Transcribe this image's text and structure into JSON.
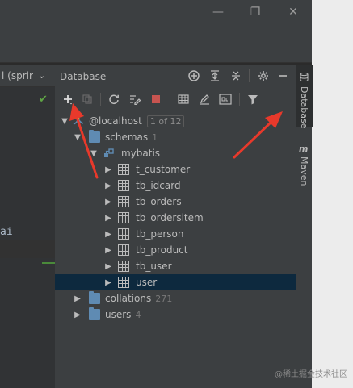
{
  "window": {
    "minimize_glyph": "—",
    "restore_glyph": "❐",
    "close_glyph": "✕"
  },
  "editor": {
    "tab_label": "l (sprir",
    "code_text": "ai"
  },
  "db_panel": {
    "title": "Database",
    "header_icons": [
      "add-circle-icon",
      "expand-all-icon",
      "collapse-all-icon",
      "gear-icon",
      "minimize-icon"
    ],
    "toolbar_icons": [
      "add-icon",
      "copy-icon",
      "refresh-icon",
      "properties-icon",
      "stop-icon",
      "table-view-icon",
      "edit-icon",
      "console-icon",
      "filter-icon"
    ]
  },
  "tree": {
    "root": {
      "label": "@localhost",
      "badge": "1 of 12"
    },
    "schemas": {
      "label": "schemas",
      "count": "1"
    },
    "schema": {
      "label": "mybatis"
    },
    "tables": [
      "t_customer",
      "tb_idcard",
      "tb_orders",
      "tb_ordersitem",
      "tb_person",
      "tb_product",
      "tb_user",
      "user"
    ],
    "selected_table": "user",
    "collations": {
      "label": "collations",
      "count": "271"
    },
    "users": {
      "label": "users",
      "count": "4"
    }
  },
  "right_strip": {
    "database_label": "Database",
    "maven_label": "Maven",
    "maven_icon": "m"
  },
  "colors": {
    "selection": "#0d293e",
    "annotation_arrow": "#e8392b",
    "folder": "#5f8bb3"
  },
  "watermark": "@稀土掘金技术社区"
}
